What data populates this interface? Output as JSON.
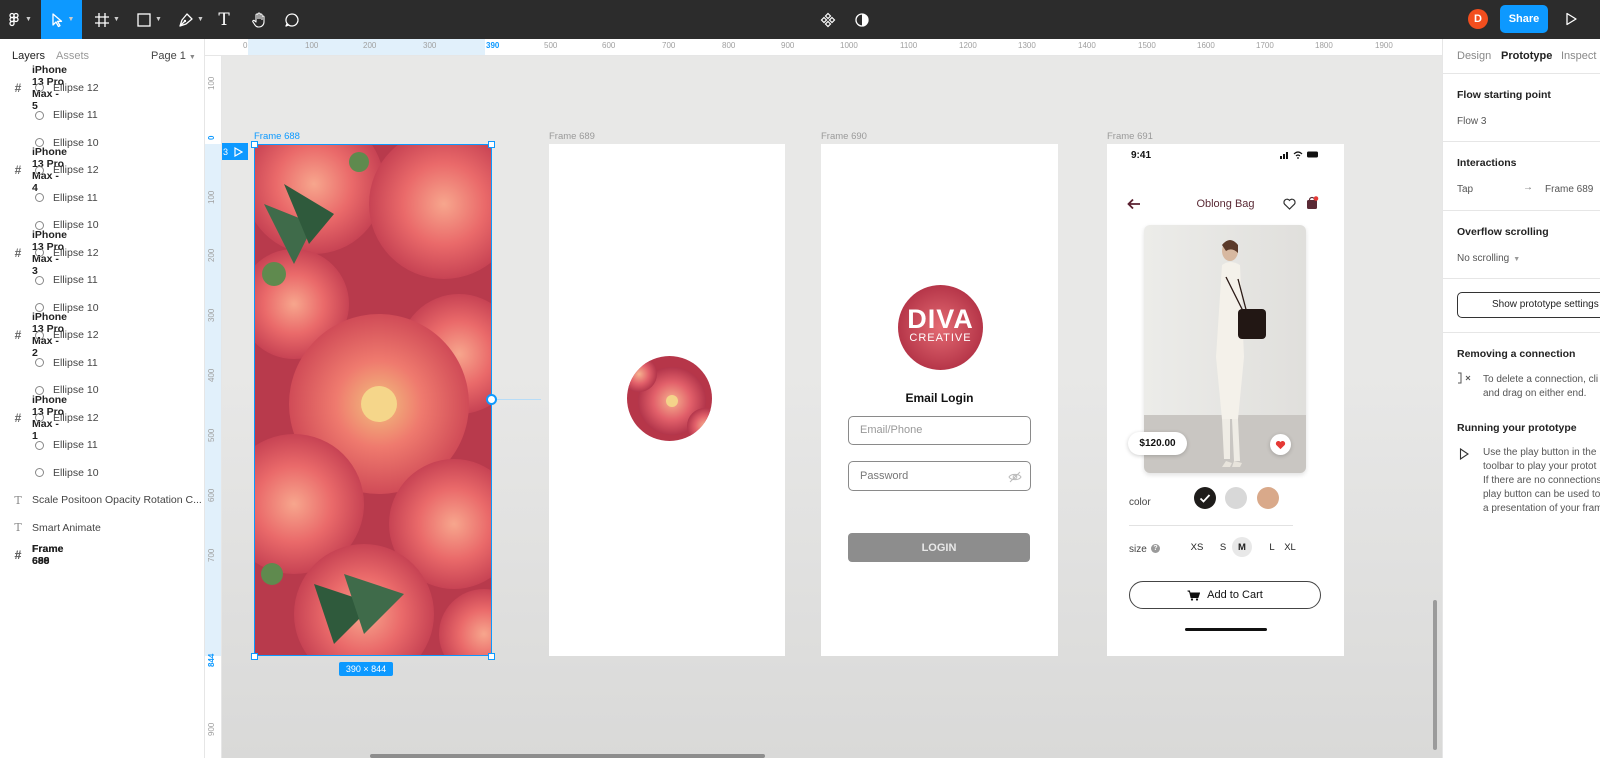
{
  "toolbar": {
    "main_menu_icon": "figma-logo-icon",
    "move_tool_icon": "cursor-icon",
    "frame_tool_icon": "frame-icon",
    "shape_tool_icon": "rectangle-icon",
    "pen_tool_icon": "pen-icon",
    "text_tool_icon": "text-icon",
    "hand_tool_icon": "hand-icon",
    "comment_tool_icon": "comment-icon",
    "component_icon": "components-icon",
    "contrast_icon": "half-circle-icon",
    "avatar_initial": "D",
    "share_label": "Share",
    "present_icon": "play-icon",
    "text_tool_glyph": "T"
  },
  "left_panel": {
    "tabs": {
      "layers": "Layers",
      "assets": "Assets"
    },
    "page": "Page 1",
    "layers": [
      {
        "kind": "frame",
        "label": "iPhone 13 Pro Max - 5"
      },
      {
        "kind": "child",
        "label": "Ellipse 12"
      },
      {
        "kind": "child",
        "label": "Ellipse 11"
      },
      {
        "kind": "child",
        "label": "Ellipse 10"
      },
      {
        "kind": "frame",
        "label": "iPhone 13 Pro Max - 4"
      },
      {
        "kind": "child",
        "label": "Ellipse 12"
      },
      {
        "kind": "child",
        "label": "Ellipse 11"
      },
      {
        "kind": "child",
        "label": "Ellipse 10"
      },
      {
        "kind": "frame",
        "label": "iPhone 13 Pro Max - 3"
      },
      {
        "kind": "child",
        "label": "Ellipse 12"
      },
      {
        "kind": "child",
        "label": "Ellipse 11"
      },
      {
        "kind": "child",
        "label": "Ellipse 10"
      },
      {
        "kind": "frame",
        "label": "iPhone 13 Pro Max - 2"
      },
      {
        "kind": "child",
        "label": "Ellipse 12"
      },
      {
        "kind": "child",
        "label": "Ellipse 11"
      },
      {
        "kind": "child",
        "label": "Ellipse 10"
      },
      {
        "kind": "frame",
        "label": "iPhone 13 Pro Max - 1"
      },
      {
        "kind": "child",
        "label": "Ellipse 12"
      },
      {
        "kind": "child",
        "label": "Ellipse 11"
      },
      {
        "kind": "child",
        "label": "Ellipse 10"
      },
      {
        "kind": "text",
        "label": "Scale Positoon Opacity Rotation C..."
      },
      {
        "kind": "text",
        "label": "Smart Animate"
      },
      {
        "kind": "frame",
        "label": "Frame 690"
      },
      {
        "kind": "frame",
        "label": "Frame 689"
      },
      {
        "kind": "frame",
        "label": "Frame 688",
        "selected": true
      }
    ]
  },
  "rulers": {
    "top": [
      "0",
      "100",
      "200",
      "300",
      "390",
      "500",
      "600",
      "700",
      "800",
      "900",
      "1000",
      "1100",
      "1200",
      "1300",
      "1400",
      "1500",
      "1600",
      "1700",
      "1800",
      "1900"
    ],
    "left": [
      "100",
      "0",
      "100",
      "200",
      "300",
      "400",
      "500",
      "600",
      "700",
      "844",
      "900"
    ]
  },
  "canvas": {
    "frames": {
      "f688": {
        "name": "Frame 688",
        "size_badge": "390 × 844",
        "flow_badge": "3"
      },
      "f689": {
        "name": "Frame 689"
      },
      "f690": {
        "name": "Frame 690"
      },
      "f691": {
        "name": "Frame 691"
      }
    },
    "login": {
      "logo_line1": "DIVA",
      "logo_line2": "CREATIVE",
      "title": "Email Login",
      "email_placeholder": "Email/Phone",
      "password_placeholder": "Password",
      "login_button": "LOGIN"
    },
    "product": {
      "status_time": "9:41",
      "title": "Oblong Bag",
      "price": "$120.00",
      "color_label": "color",
      "colors": [
        "#1e1c1a",
        "#d8d8d8",
        "#d9a98a"
      ],
      "size_label": "size",
      "sizes": [
        "XS",
        "S",
        "M",
        "L",
        "XL"
      ],
      "selected_size": "M",
      "add_to_cart": "Add to Cart"
    }
  },
  "right_panel": {
    "tabs": {
      "design": "Design",
      "prototype": "Prototype",
      "inspect": "Inspect"
    },
    "flow_starting_point": {
      "title": "Flow starting point",
      "value": "Flow 3"
    },
    "interactions": {
      "title": "Interactions",
      "trigger": "Tap",
      "destination": "Frame 689"
    },
    "overflow": {
      "title": "Overflow scrolling",
      "value": "No scrolling"
    },
    "show_settings_button": "Show prototype settings",
    "removing": {
      "title": "Removing a connection",
      "line1": "To delete a connection, cli",
      "line2": "and drag on either end."
    },
    "running": {
      "title": "Running your prototype",
      "lines": [
        "Use the play button in the",
        "toolbar to play your protot",
        "If there are no connections",
        "play button can be used to",
        "a presentation of your fram"
      ]
    }
  }
}
